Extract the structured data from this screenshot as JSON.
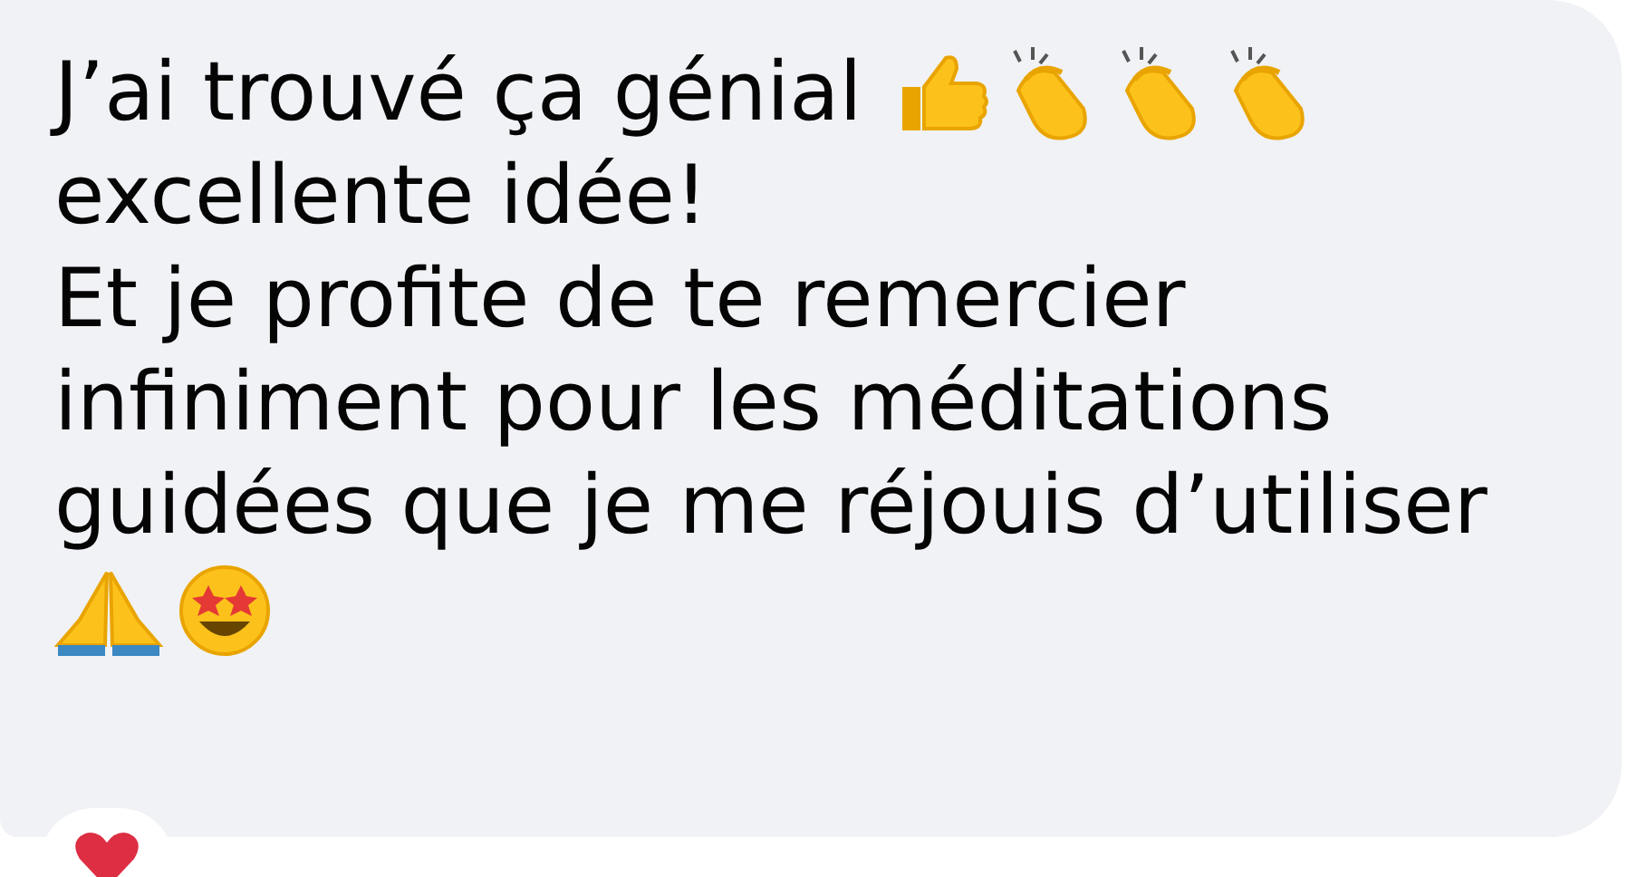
{
  "message": {
    "paragraphs": [
      {
        "text": "J’ai trouvé ça génial",
        "after_icons": "excellente idée!"
      },
      {
        "text": "Et je profite de te remercier infiniment pour les méditations guidées que je me réjouis d’utiliser"
      }
    ]
  }
}
